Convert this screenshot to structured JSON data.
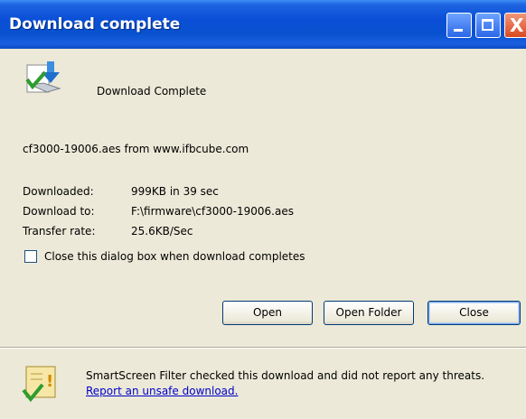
{
  "window": {
    "title": "Download complete",
    "controls": {
      "minimize_icon": "minimize-icon",
      "maximize_icon": "maximize-icon",
      "close_glyph": "X"
    }
  },
  "header": {
    "icon": "download-complete-icon",
    "text": "Download Complete"
  },
  "source": "cf3000-19006.aes from www.ifbcube.com",
  "details": [
    {
      "label": "Downloaded:",
      "value": "999KB in 39 sec"
    },
    {
      "label": "Download to:",
      "value": "F:\\firmware\\cf3000-19006.aes"
    },
    {
      "label": "Transfer rate:",
      "value": "25.6KB/Sec"
    }
  ],
  "close_checkbox": {
    "label": "Close this dialog box when download completes",
    "checked": false
  },
  "buttons": {
    "open": "Open",
    "open_folder": "Open Folder",
    "close": "Close"
  },
  "smartscreen": {
    "icon": "smartscreen-shield-icon",
    "text": "SmartScreen Filter checked this download and did not report any threats. ",
    "link": "Report an unsafe download."
  }
}
